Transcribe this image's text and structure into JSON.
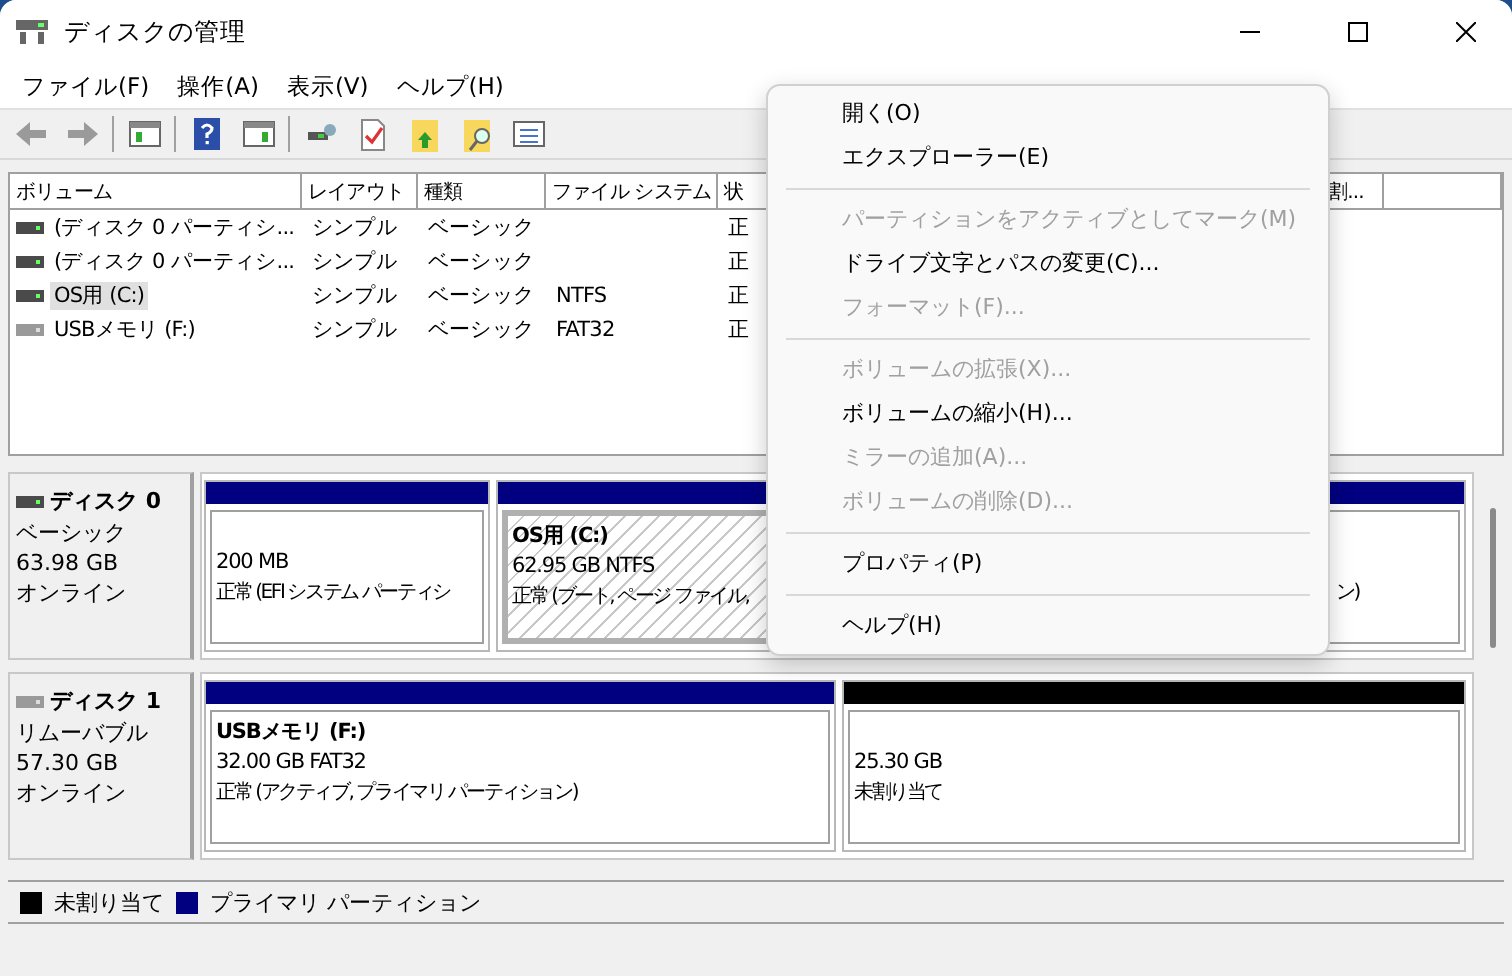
{
  "window": {
    "title": "ディスクの管理"
  },
  "menu_bar": [
    "ファイル(F)",
    "操作(A)",
    "表示(V)",
    "ヘルプ(H)"
  ],
  "toolbar": [
    {
      "kind": "back"
    },
    {
      "kind": "forward"
    },
    {
      "kind": "sep"
    },
    {
      "kind": "pane"
    },
    {
      "kind": "sep"
    },
    {
      "kind": "help"
    },
    {
      "kind": "pane2"
    },
    {
      "kind": "sep"
    },
    {
      "kind": "connect"
    },
    {
      "kind": "check"
    },
    {
      "kind": "folder-up"
    },
    {
      "kind": "folder-search"
    },
    {
      "kind": "list"
    }
  ],
  "volume_list": {
    "columns": [
      {
        "label": "ボリューム"
      },
      {
        "label": "レイアウト"
      },
      {
        "label": "種類"
      },
      {
        "label": "ファイル システム"
      },
      {
        "label": "状"
      },
      {
        "label": "割..."
      }
    ],
    "rows": [
      {
        "cells": [
          "(ディスク 0 パーティシ...",
          "シンプル",
          "ベーシック",
          "",
          "正"
        ],
        "selected": false,
        "removable": false
      },
      {
        "cells": [
          "(ディスク 0 パーティシ...",
          "シンプル",
          "ベーシック",
          "",
          "正"
        ],
        "selected": false,
        "removable": false
      },
      {
        "cells": [
          "OS用 (C:)",
          "シンプル",
          "ベーシック",
          "NTFS",
          "正"
        ],
        "selected": true,
        "removable": false
      },
      {
        "cells": [
          "USBメモリ (F:)",
          "シンプル",
          "ベーシック",
          "FAT32",
          "正"
        ],
        "selected": false,
        "removable": true
      }
    ]
  },
  "disks": [
    {
      "name": "ディスク 0",
      "type": "ベーシック",
      "size": "63.98 GB",
      "status": "オンライン",
      "removable": false,
      "partitions": [
        {
          "kind": "primary",
          "selected": false,
          "size": "200 MB",
          "status": "正常 (EFI システム パーティシ"
        },
        {
          "kind": "primary",
          "selected": true,
          "label": "OS用 (C:)",
          "size": "62.95 GB NTFS",
          "status": "正常 (ブート, ページ ファイル,"
        },
        {
          "kind": "primary",
          "selected": false,
          "status": "ン)"
        }
      ]
    },
    {
      "name": "ディスク 1",
      "type": "リムーバブル",
      "size": "57.30 GB",
      "status": "オンライン",
      "removable": true,
      "partitions": [
        {
          "kind": "primary",
          "selected": false,
          "label": "USBメモリ (F:)",
          "size": "32.00 GB FAT32",
          "status": "正常 (アクティブ, プライマリ パーティション)"
        },
        {
          "kind": "unallocated",
          "selected": false,
          "size": "25.30 GB",
          "status": "未割り当て"
        }
      ]
    }
  ],
  "legend": [
    {
      "label": "未割り当て",
      "color": "#000000"
    },
    {
      "label": "プライマリ パーティション",
      "color": "#000080"
    }
  ],
  "context_menu": [
    {
      "kind": "item",
      "label": "開く(O)",
      "disabled": false
    },
    {
      "kind": "item",
      "label": "エクスプローラー(E)",
      "disabled": false
    },
    {
      "kind": "separator"
    },
    {
      "kind": "item",
      "label": "パーティションをアクティブとしてマーク(M)",
      "disabled": true
    },
    {
      "kind": "item",
      "label": "ドライブ文字とパスの変更(C)...",
      "disabled": false
    },
    {
      "kind": "item",
      "label": "フォーマット(F)...",
      "disabled": true
    },
    {
      "kind": "separator"
    },
    {
      "kind": "item",
      "label": "ボリュームの拡張(X)...",
      "disabled": true
    },
    {
      "kind": "item",
      "label": "ボリュームの縮小(H)...",
      "disabled": false
    },
    {
      "kind": "item",
      "label": "ミラーの追加(A)...",
      "disabled": true
    },
    {
      "kind": "item",
      "label": "ボリュームの削除(D)...",
      "disabled": true
    },
    {
      "kind": "separator"
    },
    {
      "kind": "item",
      "label": "プロパティ(P)",
      "disabled": false
    },
    {
      "kind": "separator"
    },
    {
      "kind": "item",
      "label": "ヘルプ(H)",
      "disabled": false
    }
  ]
}
